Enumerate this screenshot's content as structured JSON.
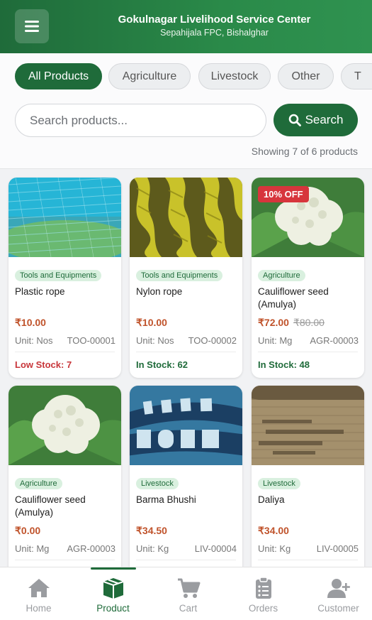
{
  "header": {
    "title": "Gokulnagar Livelihood Service Center",
    "subtitle": "Sepahijala FPC, Bishalghar"
  },
  "filters": {
    "chips": [
      "All Products",
      "Agriculture",
      "Livestock",
      "Other",
      "T"
    ],
    "active": "All Products"
  },
  "search": {
    "placeholder": "Search products...",
    "value": "",
    "button_label": "Search"
  },
  "results": {
    "showing_text": "Showing 7 of 6 products"
  },
  "products": [
    {
      "category": "Tools and Equipments",
      "name": "Plastic rope",
      "price": "₹10.00",
      "old_price": "",
      "discount": "",
      "unit": "Unit: Nos",
      "code": "TOO-00001",
      "stock": "Low Stock: 7",
      "stock_status": "low",
      "image": "blue-rope-image"
    },
    {
      "category": "Tools and Equipments",
      "name": "Nylon rope",
      "price": "₹10.00",
      "old_price": "",
      "discount": "",
      "unit": "Unit: Nos",
      "code": "TOO-00002",
      "stock": "In Stock: 62",
      "stock_status": "in",
      "image": "yellow-rope-image"
    },
    {
      "category": "Agriculture",
      "name": "Cauliflower seed (Amulya)",
      "price": "₹72.00",
      "old_price": "₹80.00",
      "discount": "10% OFF",
      "unit": "Unit: Mg",
      "code": "AGR-00003",
      "stock": "In Stock: 48",
      "stock_status": "in",
      "image": "cauliflower-image"
    },
    {
      "category": "Agriculture",
      "name": "Cauliflower seed (Amulya)",
      "price": "₹0.00",
      "old_price": "",
      "discount": "",
      "unit": "Unit: Mg",
      "code": "AGR-00003",
      "stock": "",
      "stock_status": "",
      "image": "cauliflower-image"
    },
    {
      "category": "Livestock",
      "name": "Barma Bhushi",
      "price": "₹34.50",
      "old_price": "",
      "discount": "",
      "unit": "Unit: Kg",
      "code": "LIV-00004",
      "stock": "",
      "stock_status": "",
      "image": "feed-bag-image"
    },
    {
      "category": "Livestock",
      "name": "Daliya",
      "price": "₹34.00",
      "old_price": "",
      "discount": "",
      "unit": "Unit: Kg",
      "code": "LIV-00005",
      "stock": "",
      "stock_status": "",
      "image": "jute-sack-image"
    }
  ],
  "bottom_nav": {
    "items": [
      {
        "label": "Home",
        "icon": "home-icon"
      },
      {
        "label": "Product",
        "icon": "box-icon"
      },
      {
        "label": "Cart",
        "icon": "cart-icon"
      },
      {
        "label": "Orders",
        "icon": "clipboard-icon"
      },
      {
        "label": "Customer",
        "icon": "add-user-icon"
      }
    ],
    "active": "Product"
  },
  "colors": {
    "primary": "#1f6b3a",
    "price": "#c0532b",
    "low_stock": "#c8363a",
    "discount_badge": "#d7353c"
  }
}
